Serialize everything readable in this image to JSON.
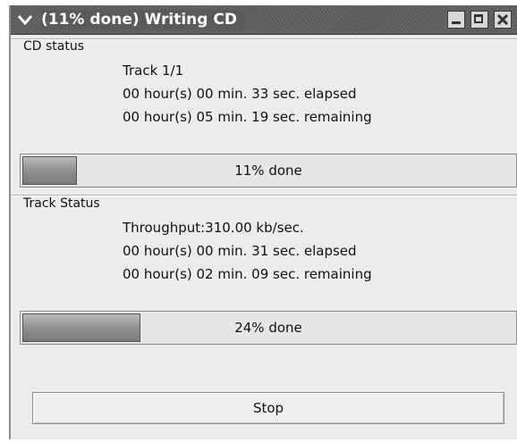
{
  "window": {
    "title": "(11% done) Writing CD"
  },
  "cd_status": {
    "label": "CD status",
    "track": "Track 1/1",
    "elapsed": "00 hour(s) 00 min. 33 sec. elapsed",
    "remaining": "00 hour(s) 05 min. 19 sec. remaining",
    "progress_percent": 11,
    "progress_text": "11% done"
  },
  "track_status": {
    "label": "Track Status",
    "throughput": "Throughput:310.00 kb/sec.",
    "elapsed": "00 hour(s) 00 min. 31 sec. elapsed",
    "remaining": "00 hour(s) 02 min. 09 sec. remaining",
    "progress_percent": 24,
    "progress_text": "24% done"
  },
  "actions": {
    "stop_label": "Stop"
  },
  "icons": {
    "window_menu": "chevron-down-icon",
    "minimize": "minimize-icon",
    "maximize": "maximize-icon",
    "close": "close-icon"
  },
  "colors": {
    "titlebar": "#5a5a5a",
    "window_bg": "#ececec",
    "progress_fill": "#8e8e8e"
  }
}
